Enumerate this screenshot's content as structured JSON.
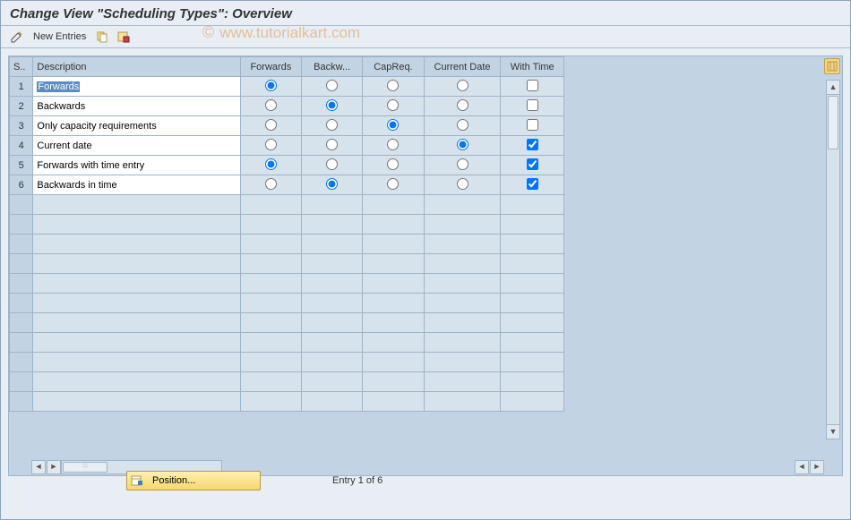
{
  "header": {
    "title": "Change View \"Scheduling Types\": Overview"
  },
  "toolbar": {
    "new_entries_label": "New Entries"
  },
  "watermark": {
    "symbol": "©",
    "text": "www.tutorialkart.com"
  },
  "table": {
    "columns": {
      "s": "S..",
      "description": "Description",
      "forwards": "Forwards",
      "backwards": "Backw...",
      "capreq": "CapReq.",
      "current_date": "Current Date",
      "with_time": "With Time"
    },
    "rows": [
      {
        "num": "1",
        "desc": "Forwards",
        "sel": "forwards",
        "with_time": false,
        "highlighted": true
      },
      {
        "num": "2",
        "desc": "Backwards",
        "sel": "backwards",
        "with_time": false,
        "highlighted": false
      },
      {
        "num": "3",
        "desc": "Only capacity requirements",
        "sel": "capreq",
        "with_time": false,
        "highlighted": false
      },
      {
        "num": "4",
        "desc": "Current date",
        "sel": "current_date",
        "with_time": true,
        "highlighted": false
      },
      {
        "num": "5",
        "desc": "Forwards with time entry",
        "sel": "forwards",
        "with_time": true,
        "highlighted": false
      },
      {
        "num": "6",
        "desc": "Backwards in time",
        "sel": "backwards",
        "with_time": true,
        "highlighted": false
      }
    ],
    "empty_rows": 11
  },
  "footer": {
    "position_label": "Position...",
    "entry_info": "Entry 1 of 6"
  }
}
